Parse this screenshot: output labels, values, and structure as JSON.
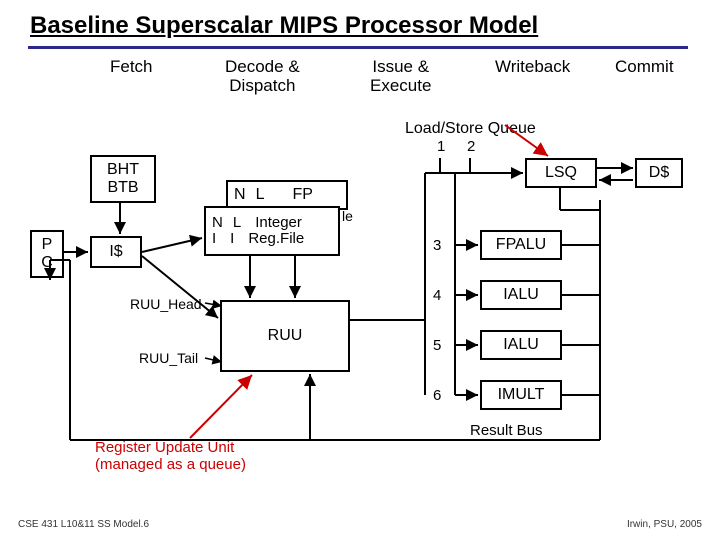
{
  "title": "Baseline Superscalar MIPS Processor Model",
  "stages": {
    "fetch": "Fetch",
    "decode": "Decode &\nDispatch",
    "issue": "Issue &\nExecute",
    "writeback": "Writeback",
    "commit": "Commit"
  },
  "labels": {
    "lsq_title": "Load/Store Queue",
    "lsq_1": "1",
    "lsq_2": "2",
    "lsq_box": "LSQ",
    "dcache": "D$",
    "fp_regfile_n": "N",
    "fp_regfile_l": "L",
    "fp_regfile_fp": "FP",
    "int_regfile_n1": "N",
    "int_regfile_l1": "L",
    "int_regfile_int": "Integer",
    "int_regfile_i1": "I",
    "int_regfile_i2": "I",
    "int_regfile_rf": "Reg.File",
    "int_regfile_le": "le",
    "bht_btb_1": "BHT",
    "bht_btb_2": "BTB",
    "pc_1": "P",
    "pc_2": "C",
    "icache": "I$",
    "ruu_head": "RUU_Head",
    "ruu_tail": "RUU_Tail",
    "ruu": "RUU",
    "fpalu": "FPALU",
    "ialu1": "IALU",
    "ialu2": "IALU",
    "imult": "IMULT",
    "port3": "3",
    "port4": "4",
    "port5": "5",
    "port6": "6",
    "result_bus": "Result Bus",
    "ruu_note_1": "Register Update Unit",
    "ruu_note_2": "(managed as a queue)"
  },
  "footer": {
    "left": "CSE 431  L10&11 SS Model.6",
    "right": "Irwin, PSU, 2005"
  }
}
